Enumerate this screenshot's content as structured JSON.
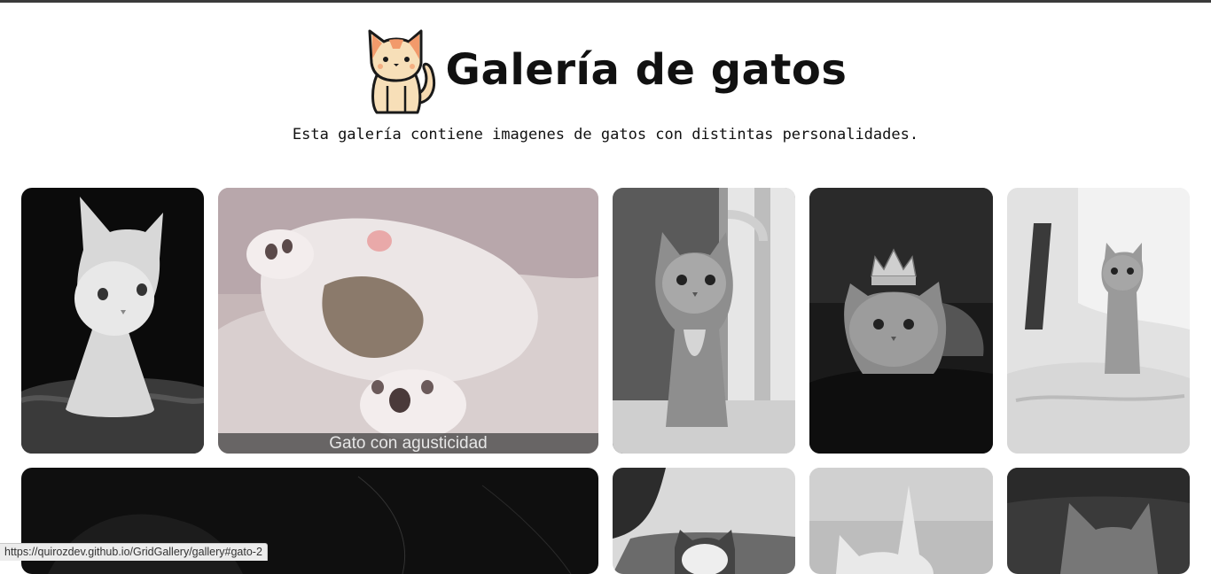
{
  "header": {
    "title": "Galería de gatos",
    "subtitle": "Esta galería contiene imagenes de gatos con distintas personalidades."
  },
  "gallery": {
    "items": [
      {
        "id": "gato-1",
        "alt": "white kitten photo"
      },
      {
        "id": "gato-2",
        "caption": "Gato con agusticidad"
      },
      {
        "id": "gato-3",
        "alt": "tabby cat at door photo"
      },
      {
        "id": "gato-4",
        "alt": "cat with crown photo"
      },
      {
        "id": "gato-5",
        "alt": "kitten on bed photo"
      },
      {
        "id": "gato-6",
        "alt": "dark cat photo"
      },
      {
        "id": "gato-7",
        "alt": "kitten in grass photo"
      },
      {
        "id": "gato-8",
        "alt": "white cat photo"
      },
      {
        "id": "gato-9",
        "alt": "cat close-up photo"
      }
    ]
  },
  "status_bar": {
    "url": "https://quirozdev.github.io/GridGallery/gallery#gato-2"
  },
  "colors": {
    "caption_overlay": "#3c3c3c",
    "text": "#111111"
  }
}
